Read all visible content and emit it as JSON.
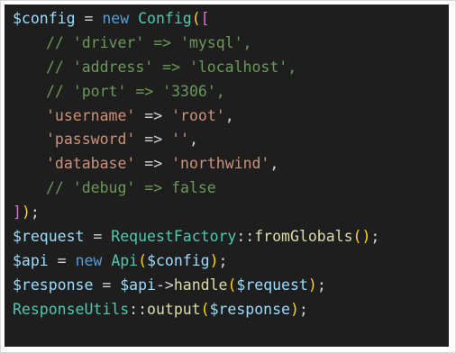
{
  "editor": {
    "lines": [
      [
        {
          "text": "$config",
          "color": "#9cdcfe"
        },
        {
          "text": " = ",
          "color": "#d4d4d4"
        },
        {
          "text": "new",
          "color": "#569cd6"
        },
        {
          "text": " ",
          "color": "#d4d4d4"
        },
        {
          "text": "Config",
          "color": "#4ec9b0"
        },
        {
          "text": "(",
          "color": "#ffd700"
        },
        {
          "text": "[",
          "color": "#da70d6"
        }
      ],
      [
        {
          "text": "// 'driver' => 'mysql',",
          "color": "#6a9955"
        }
      ],
      [
        {
          "text": "// 'address' => 'localhost',",
          "color": "#6a9955"
        }
      ],
      [
        {
          "text": "// 'port' => '3306',",
          "color": "#6a9955"
        }
      ],
      [
        {
          "text": "'username'",
          "color": "#ce9178"
        },
        {
          "text": " => ",
          "color": "#d4d4d4"
        },
        {
          "text": "'root'",
          "color": "#ce9178"
        },
        {
          "text": ",",
          "color": "#d4d4d4"
        }
      ],
      [
        {
          "text": "'password'",
          "color": "#ce9178"
        },
        {
          "text": " => ",
          "color": "#d4d4d4"
        },
        {
          "text": "''",
          "color": "#ce9178"
        },
        {
          "text": ",",
          "color": "#d4d4d4"
        }
      ],
      [
        {
          "text": "'database'",
          "color": "#ce9178"
        },
        {
          "text": " => ",
          "color": "#d4d4d4"
        },
        {
          "text": "'northwind'",
          "color": "#ce9178"
        },
        {
          "text": ",",
          "color": "#d4d4d4"
        }
      ],
      [
        {
          "text": "// 'debug' => false",
          "color": "#6a9955"
        }
      ],
      [
        {
          "text": "]",
          "color": "#da70d6"
        },
        {
          "text": ")",
          "color": "#ffd700"
        },
        {
          "text": ";",
          "color": "#d4d4d4"
        }
      ],
      [
        {
          "text": "$request",
          "color": "#9cdcfe"
        },
        {
          "text": " = ",
          "color": "#d4d4d4"
        },
        {
          "text": "RequestFactory",
          "color": "#4ec9b0"
        },
        {
          "text": "::",
          "color": "#d4d4d4"
        },
        {
          "text": "fromGlobals",
          "color": "#dcdcaa"
        },
        {
          "text": "()",
          "color": "#ffd700"
        },
        {
          "text": ";",
          "color": "#d4d4d4"
        }
      ],
      [
        {
          "text": "$api",
          "color": "#9cdcfe"
        },
        {
          "text": " = ",
          "color": "#d4d4d4"
        },
        {
          "text": "new",
          "color": "#569cd6"
        },
        {
          "text": " ",
          "color": "#d4d4d4"
        },
        {
          "text": "Api",
          "color": "#4ec9b0"
        },
        {
          "text": "(",
          "color": "#ffd700"
        },
        {
          "text": "$config",
          "color": "#9cdcfe"
        },
        {
          "text": ")",
          "color": "#ffd700"
        },
        {
          "text": ";",
          "color": "#d4d4d4"
        }
      ],
      [
        {
          "text": "$response",
          "color": "#9cdcfe"
        },
        {
          "text": " = ",
          "color": "#d4d4d4"
        },
        {
          "text": "$api",
          "color": "#9cdcfe"
        },
        {
          "text": "->",
          "color": "#d4d4d4"
        },
        {
          "text": "handle",
          "color": "#dcdcaa"
        },
        {
          "text": "(",
          "color": "#ffd700"
        },
        {
          "text": "$request",
          "color": "#9cdcfe"
        },
        {
          "text": ")",
          "color": "#ffd700"
        },
        {
          "text": ";",
          "color": "#d4d4d4"
        }
      ],
      [
        {
          "text": "ResponseUtils",
          "color": "#4ec9b0"
        },
        {
          "text": "::",
          "color": "#d4d4d4"
        },
        {
          "text": "output",
          "color": "#dcdcaa"
        },
        {
          "text": "(",
          "color": "#ffd700"
        },
        {
          "text": "$response",
          "color": "#9cdcfe"
        },
        {
          "text": ")",
          "color": "#ffd700"
        },
        {
          "text": ";",
          "color": "#d4d4d4"
        }
      ]
    ],
    "indented_lines": [
      1,
      2,
      3,
      4,
      5,
      6,
      7
    ],
    "background": "#1e1e1e"
  }
}
